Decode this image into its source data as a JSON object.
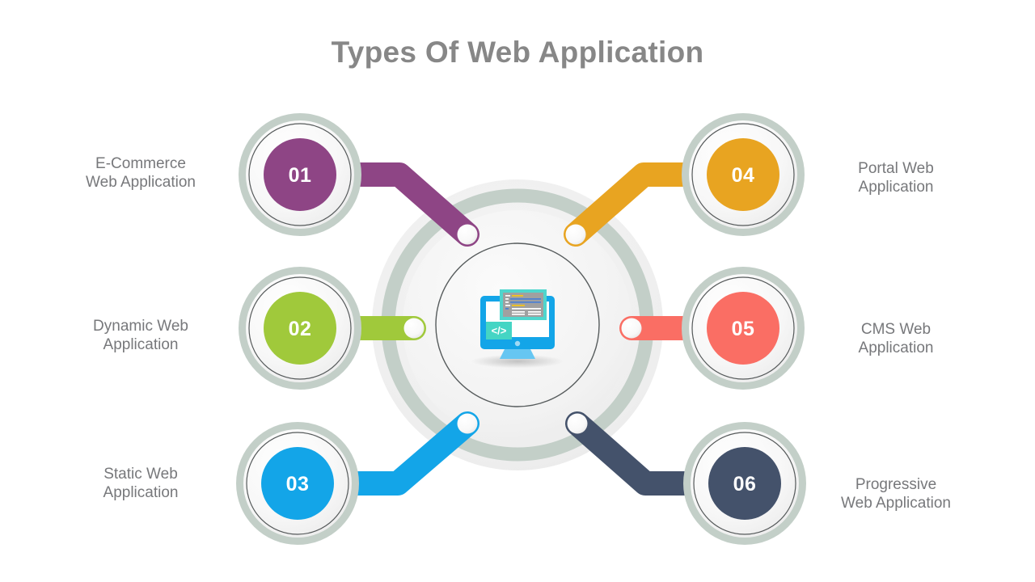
{
  "header": {
    "title": "Types Of Web Application"
  },
  "colors": {
    "title_text": "#878787",
    "caption_text": "#77787b",
    "ring_sage": "#c3cfc8",
    "disc_light": "#f5f5f5",
    "disc_outline": "#4a4a4a",
    "center_outer": "#efefef",
    "center_ring": "#c3cfc8",
    "center_inner": "#f3f3f3",
    "dot_white": "#ffffff"
  },
  "center": {
    "icon_name": "monitor-code-icon",
    "icon_colors": {
      "monitor_blue": "#13a5e8",
      "screen_white": "#ffffff",
      "stand_blue": "#66c6f2",
      "code_window_border": "#4fd6cd",
      "code_window_body": "#a0a0a0",
      "code_badge": "#45d5c4",
      "code_line_yellow": "#f5c518",
      "code_line_blue": "#4a7fd4",
      "code_line_white": "#ffffff",
      "shadow": "#c9c9c9"
    },
    "badge_glyph": "</>"
  },
  "nodes": [
    {
      "id": "node-01",
      "number": "01",
      "label": "E-Commerce\nWeb Application",
      "color": "#8e4585",
      "side": "left",
      "row": "top",
      "connector": "elbow-down-right"
    },
    {
      "id": "node-02",
      "number": "02",
      "label": "Dynamic Web\nApplication",
      "color": "#a0c93b",
      "side": "left",
      "row": "middle",
      "connector": "straight-right"
    },
    {
      "id": "node-03",
      "number": "03",
      "label": "Static Web\nApplication",
      "color": "#13a5e8",
      "side": "left",
      "row": "bottom",
      "connector": "elbow-up-right"
    },
    {
      "id": "node-04",
      "number": "04",
      "label": "Portal Web\nApplication",
      "color": "#e8a421",
      "side": "right",
      "row": "top",
      "connector": "elbow-down-left"
    },
    {
      "id": "node-05",
      "number": "05",
      "label": "CMS Web\nApplication",
      "color": "#fa6e64",
      "side": "right",
      "row": "middle",
      "connector": "straight-left"
    },
    {
      "id": "node-06",
      "number": "06",
      "label": "Progressive\nWeb Application",
      "color": "#44526b",
      "side": "right",
      "row": "bottom",
      "connector": "elbow-up-left"
    }
  ]
}
